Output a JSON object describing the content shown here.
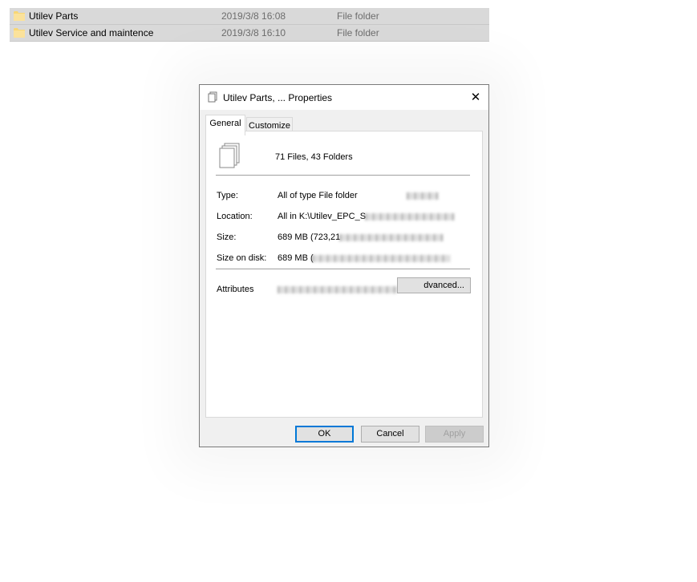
{
  "files": [
    {
      "name": "Utilev Parts",
      "date": "2019/3/8 16:08",
      "type": "File folder"
    },
    {
      "name": "Utilev Service and maintence",
      "date": "2019/3/8 16:10",
      "type": "File folder"
    }
  ],
  "dialog": {
    "title": "Utilev Parts, ... Properties",
    "close_glyph": "✕",
    "tabs": [
      {
        "label": "General",
        "active": true
      },
      {
        "label": "Customize",
        "active": false
      }
    ],
    "summary": "71 Files, 43 Folders",
    "properties": {
      "type_label": "Type:",
      "type_value": "All of type File folder",
      "location_label": "Location:",
      "location_value": "All in K:\\Utilev_EPC_S",
      "size_label": "Size:",
      "size_value": "689 MB (723,21",
      "size_on_disk_label": "Size on disk:",
      "size_on_disk_value": "689 MB ("
    },
    "attributes_label": "Attributes",
    "advanced_label": "dvanced...",
    "buttons": {
      "ok": "OK",
      "cancel": "Cancel",
      "apply": "Apply"
    }
  },
  "colors": {
    "selection_row": "#d9d9d9",
    "dialog_bg": "#f0f0f0",
    "focus_border": "#0078d7",
    "folder_yellow": "#f8d775"
  }
}
